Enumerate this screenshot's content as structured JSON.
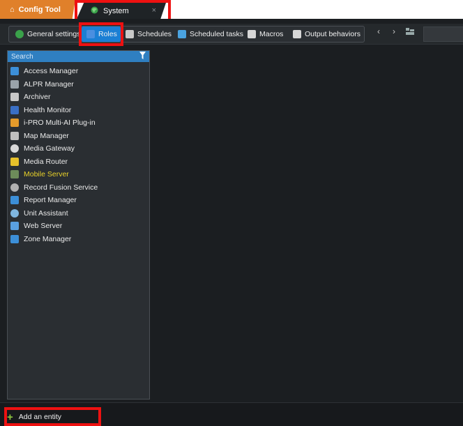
{
  "tabs": {
    "config_tool": "Config Tool",
    "system": "System",
    "close": "×"
  },
  "toolbar": {
    "items": [
      {
        "label": "General settings",
        "icon": "globe-icon",
        "color": "#3aa14a"
      },
      {
        "label": "Roles",
        "icon": "roles-icon",
        "color": "#2b79c9"
      },
      {
        "label": "Schedules",
        "icon": "calendar-icon",
        "color": "#c9c9c9"
      },
      {
        "label": "Scheduled tasks",
        "icon": "scheduled-task-icon",
        "color": "#4aa3e0"
      },
      {
        "label": "Macros",
        "icon": "macro-icon",
        "color": "#d6d6d6"
      },
      {
        "label": "Output behaviors",
        "icon": "output-icon",
        "color": "#d6d6d6"
      }
    ],
    "back": "‹",
    "forward": "›"
  },
  "left_panel": {
    "search_placeholder": "Search",
    "roles": [
      {
        "label": "Access Manager",
        "icon": "access-manager-icon",
        "color": "#3c8fd8"
      },
      {
        "label": "ALPR Manager",
        "icon": "alpr-manager-icon",
        "color": "#9aa3aa"
      },
      {
        "label": "Archiver",
        "icon": "archiver-icon",
        "color": "#c8c8c8"
      },
      {
        "label": "Health Monitor",
        "icon": "health-monitor-icon",
        "color": "#3a6fc4"
      },
      {
        "label": "i-PRO Multi-AI Plug-in",
        "icon": "plugin-icon",
        "color": "#e39a2b"
      },
      {
        "label": "Map Manager",
        "icon": "map-manager-icon",
        "color": "#bfbfbf"
      },
      {
        "label": "Media Gateway",
        "icon": "media-gateway-icon",
        "color": "#d8d8d8"
      },
      {
        "label": "Media Router",
        "icon": "media-router-icon",
        "color": "#e6c02a"
      },
      {
        "label": "Mobile Server",
        "icon": "mobile-server-icon",
        "color": "#6d8c5a"
      },
      {
        "label": "Record Fusion Service",
        "icon": "record-fusion-icon",
        "color": "#b0b0b0"
      },
      {
        "label": "Report Manager",
        "icon": "report-manager-icon",
        "color": "#3c8fd8"
      },
      {
        "label": "Unit Assistant",
        "icon": "unit-assistant-icon",
        "color": "#7fb6e0"
      },
      {
        "label": "Web Server",
        "icon": "web-server-icon",
        "color": "#5aa0e0"
      },
      {
        "label": "Zone Manager",
        "icon": "zone-manager-icon",
        "color": "#3c8fd8"
      }
    ],
    "selected_color": "#e8d12a"
  },
  "bottom": {
    "add_label": "Add an entity"
  },
  "colors": {
    "accent": "#1b7fd4",
    "highlight": "#ee1111",
    "config_tab": "#e0802a"
  }
}
